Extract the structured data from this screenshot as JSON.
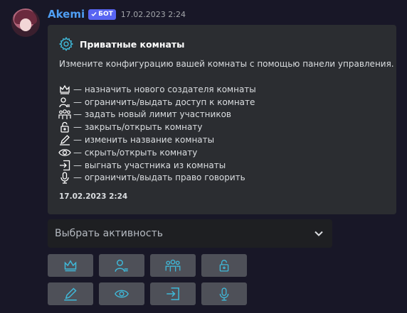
{
  "message": {
    "username": "Akemi",
    "bot_badge": "БОТ",
    "timestamp": "17.02.2023 2:24"
  },
  "embed": {
    "title": "Приватные комнаты",
    "description": "Измените конфигурацию вашей комнаты с помощью панели управления.",
    "items": [
      {
        "icon": "crown-icon",
        "label": "— назначить нового создателя комнаты"
      },
      {
        "icon": "user-access-icon",
        "label": "— ограничить/выдать доступ к комнате"
      },
      {
        "icon": "members-icon",
        "label": "— задать новый лимит участников"
      },
      {
        "icon": "lock-icon",
        "label": "— закрыть/открыть комнату"
      },
      {
        "icon": "pencil-icon",
        "label": "— изменить название комнаты"
      },
      {
        "icon": "eye-icon",
        "label": "— скрыть/открыть комнату"
      },
      {
        "icon": "kick-icon",
        "label": "— выгнать участника из комнаты"
      },
      {
        "icon": "microphone-icon",
        "label": "— ограничить/выдать право говорить"
      }
    ],
    "footer": "17.02.2023 2:24"
  },
  "select": {
    "placeholder": "Выбрать активность"
  },
  "buttons": [
    {
      "icon": "crown-icon"
    },
    {
      "icon": "user-access-icon"
    },
    {
      "icon": "members-icon"
    },
    {
      "icon": "lock-icon"
    },
    {
      "icon": "pencil-icon"
    },
    {
      "icon": "eye-icon"
    },
    {
      "icon": "kick-icon"
    },
    {
      "icon": "microphone-icon"
    }
  ],
  "colors": {
    "background": "#181727",
    "embed_bg": "#2b2d31",
    "username": "#4f9ef3",
    "bot_badge": "#5865f2",
    "icon_accent": "#3fb8d8",
    "button_bg": "#4e5058"
  }
}
